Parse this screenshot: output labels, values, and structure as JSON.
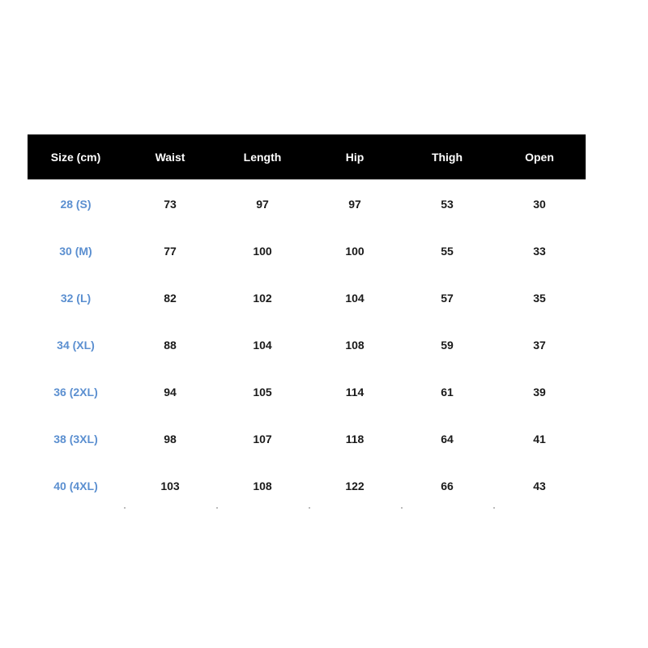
{
  "table": {
    "headers": [
      "Size (cm)",
      "Waist",
      "Length",
      "Hip",
      "Thigh",
      "Open"
    ],
    "rows": [
      [
        "28 (S)",
        "73",
        "97",
        "97",
        "53",
        "30"
      ],
      [
        "30 (M)",
        "77",
        "100",
        "100",
        "55",
        "33"
      ],
      [
        "32 (L)",
        "82",
        "102",
        "104",
        "57",
        "35"
      ],
      [
        "34 (XL)",
        "88",
        "104",
        "108",
        "59",
        "37"
      ],
      [
        "36 (2XL)",
        "94",
        "105",
        "114",
        "61",
        "39"
      ],
      [
        "38 (3XL)",
        "98",
        "107",
        "118",
        "64",
        "41"
      ],
      [
        "40 (4XL)",
        "103",
        "108",
        "122",
        "66",
        "43"
      ]
    ]
  },
  "colors": {
    "header_bg": "#000000",
    "header_text": "#ffffff",
    "size_text": "#5b8fd0",
    "value_text": "#1a1a1a"
  }
}
